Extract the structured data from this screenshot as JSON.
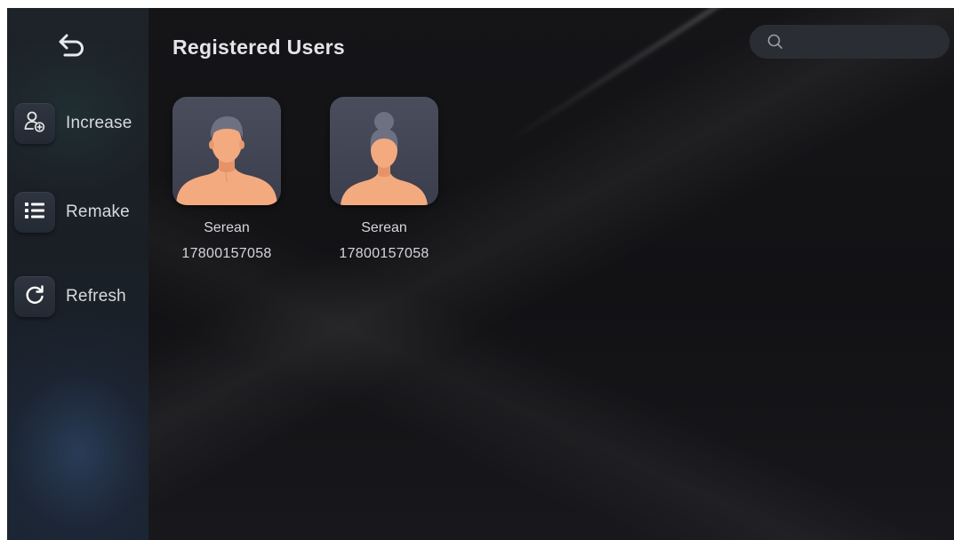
{
  "sidebar": {
    "back_icon": "back-arrow-icon",
    "items": [
      {
        "label": "Increase",
        "icon": "add-user-icon"
      },
      {
        "label": "Remake",
        "icon": "list-icon"
      },
      {
        "label": "Refresh",
        "icon": "refresh-icon"
      }
    ]
  },
  "header": {
    "title": "Registered Users"
  },
  "search": {
    "placeholder": "",
    "value": "",
    "icon": "search-icon"
  },
  "users": [
    {
      "name": "Serean",
      "phone": "17800157058",
      "avatar": "male-avatar-icon"
    },
    {
      "name": "Serean",
      "phone": "17800157058",
      "avatar": "female-avatar-icon"
    }
  ],
  "colors": {
    "background": "#131316",
    "sidebar": "#1c2229",
    "text": "#d7d9dd",
    "avatar_bg": "#464958",
    "skin": "#f4aa7f",
    "hair": "#6f7283"
  }
}
